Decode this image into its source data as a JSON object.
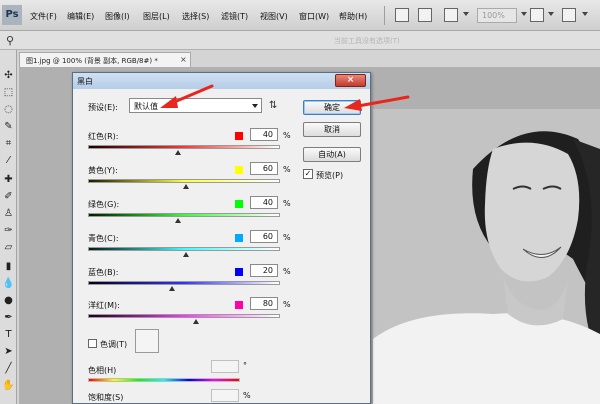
{
  "menubar": {
    "app_logo": "Ps",
    "items": [
      "文件(F)",
      "编辑(E)",
      "图像(I)",
      "图层(L)",
      "选择(S)",
      "滤镜(T)",
      "视图(V)",
      "窗口(W)",
      "帮助(H)"
    ],
    "zoom": "100%"
  },
  "options_bar": {
    "hint": "当前工具没有选项(T)"
  },
  "document": {
    "tab_title": "图1.jpg @ 100% (背景 副本, RGB/8#) *",
    "close_glyph": "×"
  },
  "dialog": {
    "title": "黑白",
    "close_glyph": "×",
    "preset_label": "预设(E):",
    "preset_value": "默认值",
    "ok_label": "确定",
    "cancel_label": "取消",
    "auto_label": "自动(A)",
    "preview_label": "预览(P)",
    "preview_checked": "✓",
    "channels": [
      {
        "label": "红色(R):",
        "value": "40",
        "unit": "%",
        "color": "#ff0000",
        "gradient": [
          "#1a0000",
          "#ff3333",
          "#ffffff"
        ],
        "fraction": 0.47
      },
      {
        "label": "黄色(Y):",
        "value": "60",
        "unit": "%",
        "color": "#ffff00",
        "gradient": [
          "#1a1a00",
          "#ffff33",
          "#ffffff"
        ],
        "fraction": 0.51
      },
      {
        "label": "绿色(G):",
        "value": "40",
        "unit": "%",
        "color": "#00ff00",
        "gradient": [
          "#001a00",
          "#33ff33",
          "#ffffff"
        ],
        "fraction": 0.47
      },
      {
        "label": "青色(C):",
        "value": "60",
        "unit": "%",
        "color": "#00aaff",
        "gradient": [
          "#001a1a",
          "#33ffff",
          "#ffffff"
        ],
        "fraction": 0.51
      },
      {
        "label": "蓝色(B):",
        "value": "20",
        "unit": "%",
        "color": "#0000ff",
        "gradient": [
          "#00001a",
          "#3333ff",
          "#ffffff"
        ],
        "fraction": 0.44
      },
      {
        "label": "洋红(M):",
        "value": "80",
        "unit": "%",
        "color": "#ff00aa",
        "gradient": [
          "#1a001a",
          "#ff33ff",
          "#ffffff"
        ],
        "fraction": 0.56
      }
    ],
    "tint_label": "色调(T)",
    "hue_label": "色相(H)",
    "hue_unit": "°",
    "saturation_label": "饱和度(S)",
    "saturation_unit": "%"
  },
  "colors": {
    "annotation_arrow": "#e8261c",
    "dialog_titlebar": "#b5cde8"
  }
}
